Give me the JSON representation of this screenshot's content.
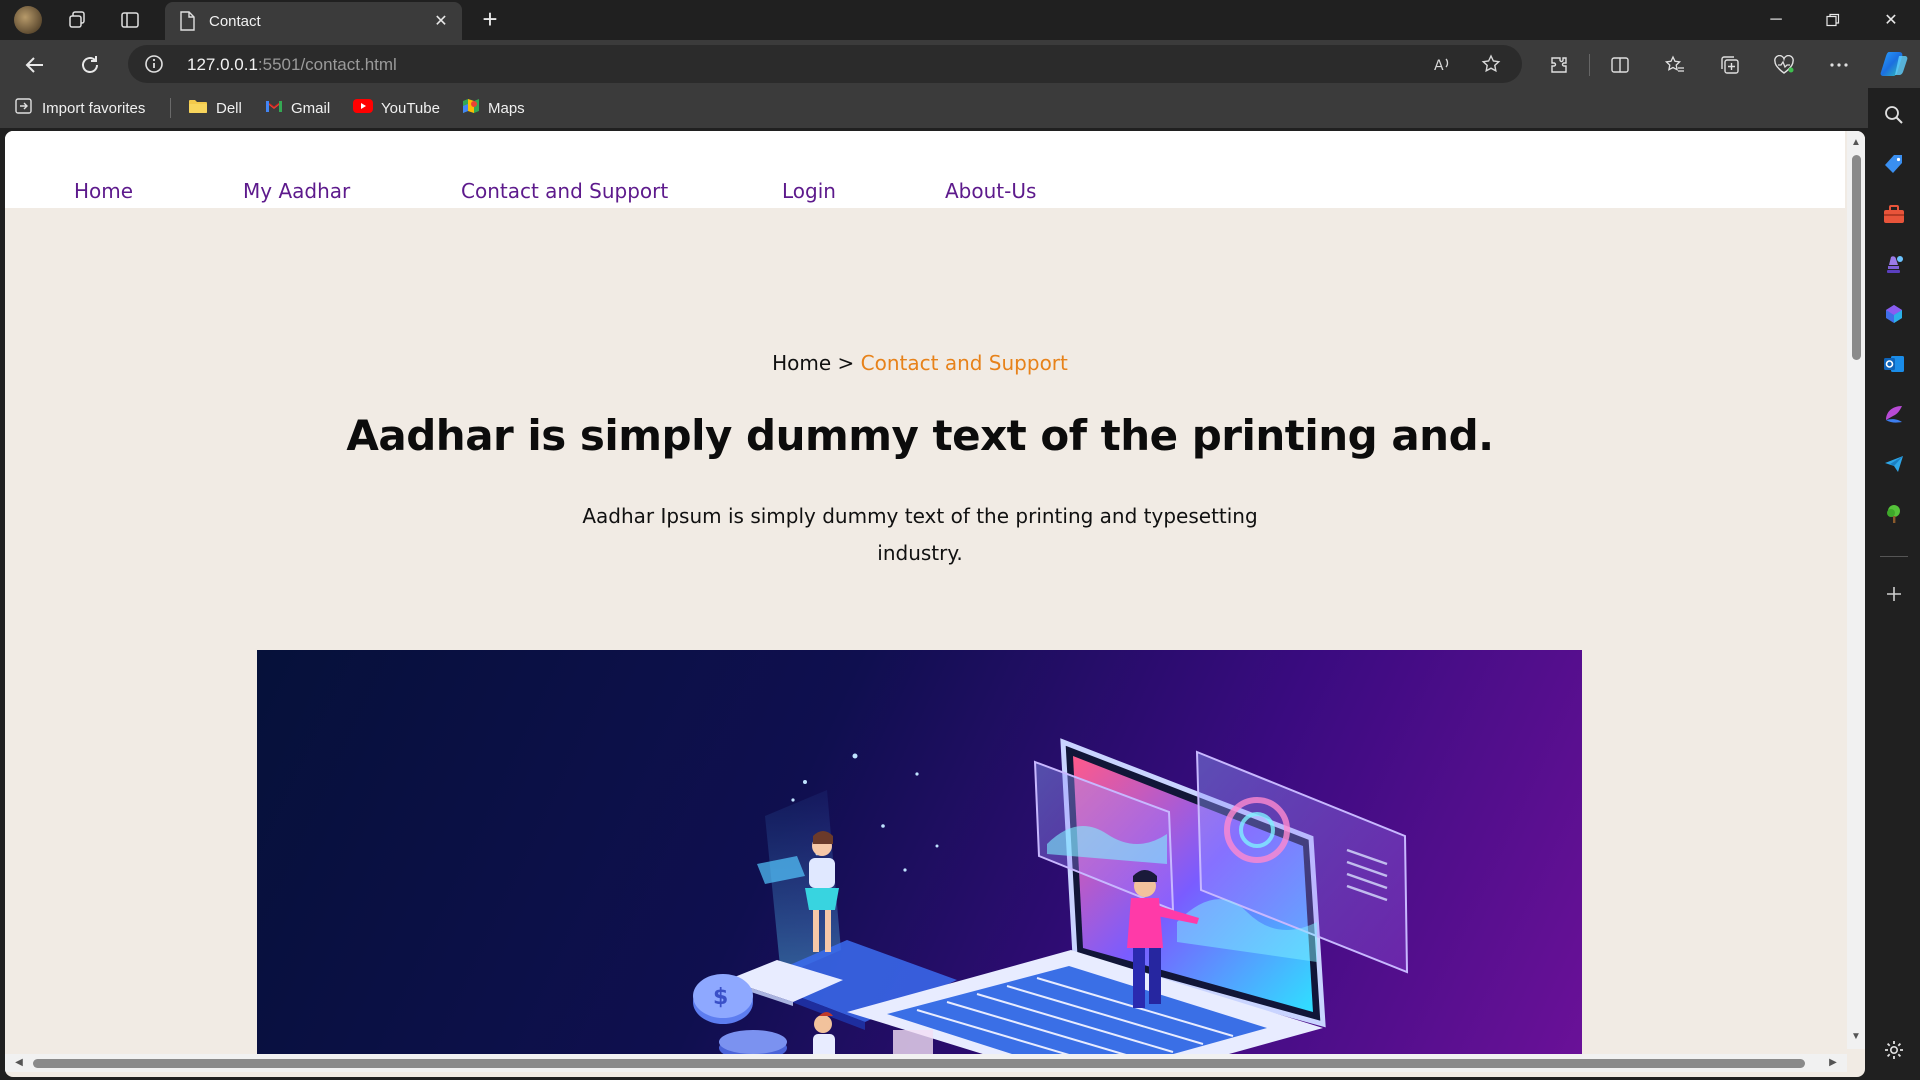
{
  "tab": {
    "title": "Contact"
  },
  "address": {
    "host": "127.0.0.1",
    "rest": ":5501/contact.html"
  },
  "favorites": [
    {
      "label": "Import favorites",
      "icon": "import-favorites-icon"
    },
    {
      "label": "Dell",
      "icon": "folder-icon"
    },
    {
      "label": "Gmail",
      "icon": "gmail-icon"
    },
    {
      "label": "YouTube",
      "icon": "youtube-icon"
    },
    {
      "label": "Maps",
      "icon": "maps-icon"
    }
  ],
  "nav": {
    "items": [
      {
        "label": "Home"
      },
      {
        "label": "My Aadhar"
      },
      {
        "label": "Contact and Support"
      },
      {
        "label": "Login"
      },
      {
        "label": "About-Us"
      }
    ]
  },
  "breadcrumb": {
    "home": "Home",
    "separator": ">",
    "current": "Contact and Support"
  },
  "hero": {
    "title": "Aadhar is simply dummy text of the printing and.",
    "subtitle": "Aadhar Ipsum is simply dummy text of the printing and typesetting industry."
  },
  "colors": {
    "nav_link": "#5d1a8c",
    "breadcrumb_current": "#e7821a",
    "page_background": "#f1ebe4",
    "hero_image_gradient": [
      "#06113a",
      "#3a0b80",
      "#6a1198"
    ]
  }
}
